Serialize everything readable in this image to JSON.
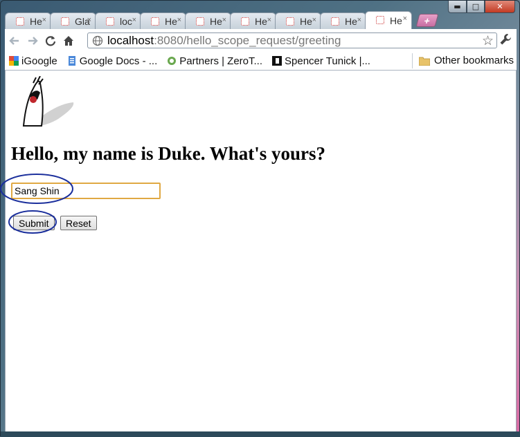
{
  "window": {
    "minimize_label": "▬",
    "maximize_label": "□",
    "close_label": "✕"
  },
  "tabs": [
    {
      "title": "He",
      "close": "×"
    },
    {
      "title": "Gla",
      "close": "×"
    },
    {
      "title": "loc",
      "close": "×"
    },
    {
      "title": "He",
      "close": "×"
    },
    {
      "title": "He",
      "close": "×"
    },
    {
      "title": "He",
      "close": "×"
    },
    {
      "title": "He",
      "close": "×"
    },
    {
      "title": "He",
      "close": "×"
    },
    {
      "title": "He",
      "close": "×"
    }
  ],
  "newtab_label": "+",
  "toolbar": {
    "url_host": "localhost",
    "url_path": ":8080/hello_scope_request/greeting",
    "star": "☆"
  },
  "bookmarks": {
    "items": [
      {
        "label": "iGoogle",
        "icon": "google-icon"
      },
      {
        "label": "Google Docs - ...",
        "icon": "docs-icon"
      },
      {
        "label": "Partners | ZeroT...",
        "icon": "zerotier-icon"
      },
      {
        "label": "Spencer Tunick |...",
        "icon": "tunick-icon"
      }
    ],
    "other": "Other bookmarks"
  },
  "page": {
    "heading": "Hello, my name is Duke. What's yours?",
    "name_value": "Sang Shin",
    "submit_label": "Submit",
    "reset_label": "Reset"
  },
  "colors": {
    "annotation": "#1b2f9c",
    "input_focus": "#e0a842"
  }
}
